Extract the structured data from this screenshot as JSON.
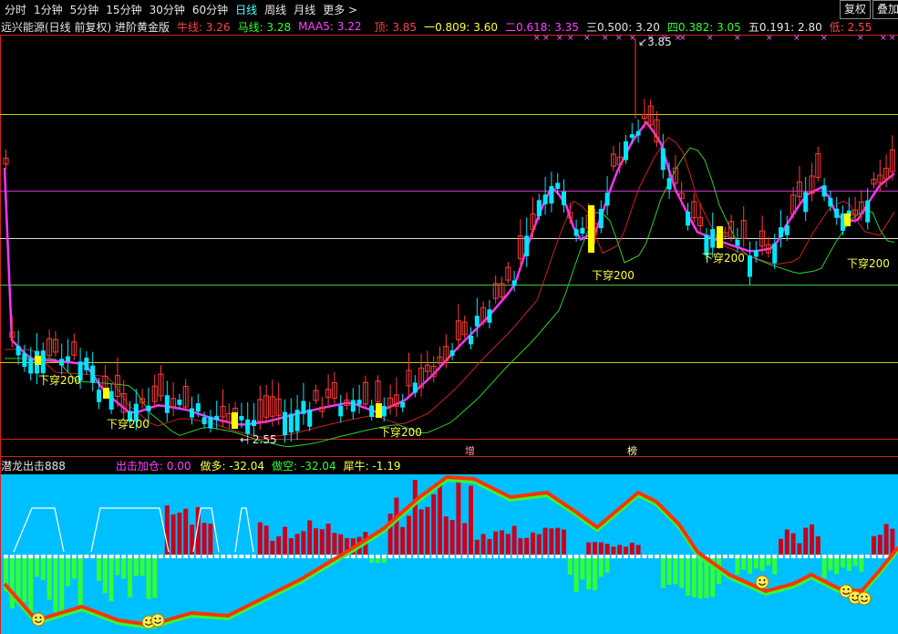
{
  "periods": [
    "分时",
    "1分钟",
    "5分钟",
    "15分钟",
    "30分钟",
    "60分钟",
    "日线",
    "周线",
    "月线",
    "更多 >"
  ],
  "active_period": "日线",
  "top_buttons": {
    "fuquan": "复权",
    "diejia": "叠加"
  },
  "info": {
    "title": "远兴能源(日线 前复权) 进阶黄金版",
    "niuxian": "牛线: 3.26",
    "maxian": "马线: 3.28",
    "maa5": "MAA5: 3.22",
    "ding": "顶: 3.85",
    "fib1": "一0.809: 3.60",
    "fib2": "二0.618: 3.35",
    "fib3": "三0.500: 3.20",
    "fib4": "四0.382: 3.05",
    "fib5": "五0.191: 2.80",
    "di": "低: 2.55"
  },
  "price_labels": {
    "high": "3.85",
    "low": "2.55"
  },
  "cross_labels": [
    "下穿200",
    "下穿200",
    "下穿200",
    "下穿200",
    "下穿200",
    "下穿200"
  ],
  "markers": {
    "zeng": "增",
    "bang": "榜"
  },
  "indicator": {
    "name": "潜龙出击888",
    "chuji": "出击加仓: 0.00",
    "zuoduo": "做多: -32.04",
    "zuokong": "做空: -32.04",
    "xiniu": "犀牛: -1.19"
  },
  "colors": {
    "bull": "#ff3b3b",
    "bear": "#00e5ff",
    "yellow": "#ffff00",
    "magenta": "#ff33ff",
    "ma_green": "#33cc33",
    "ma_red": "#cc2222",
    "panel_bg": "#00bfff",
    "hist_red": "#c8001e",
    "hist_green": "#33ff33"
  }
}
